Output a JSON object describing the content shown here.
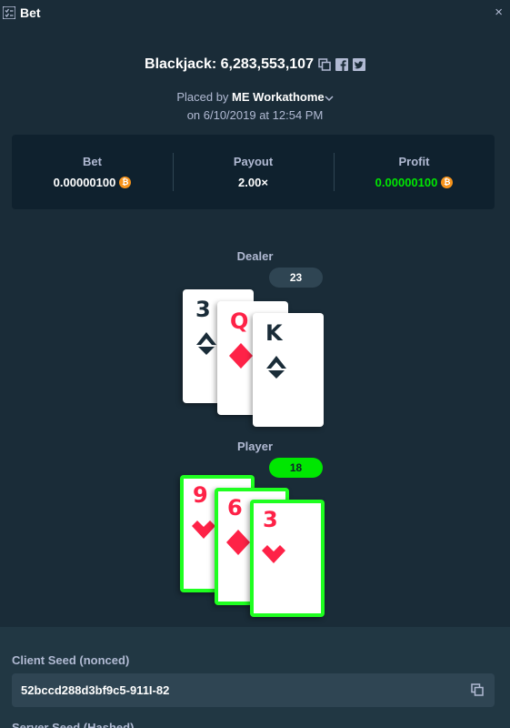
{
  "header": {
    "title": "Bet",
    "icon": "bet-list-icon",
    "close_icon": "close-icon",
    "close_glyph": "×"
  },
  "game": {
    "title": "Blackjack: 6,283,553,107",
    "placed_prefix": "Placed by",
    "user": "ME Workathome",
    "date": "on 6/10/2019 at 12:54 PM",
    "icons": [
      "copy-icon",
      "facebook-icon",
      "twitter-icon"
    ]
  },
  "stats": {
    "bet_label": "Bet",
    "bet_value": "0.00000100",
    "payout_label": "Payout",
    "payout_value": "2.00×",
    "profit_label": "Profit",
    "profit_value": "0.00000100",
    "currency_icon": "bitcoin-icon",
    "currency_glyph": "₿",
    "colors": {
      "profit": "#00e701",
      "currency": "#f7931a"
    }
  },
  "dealer": {
    "label": "Dealer",
    "score": "23",
    "cards": [
      {
        "rank": "3",
        "suit": "spade"
      },
      {
        "rank": "Q",
        "suit": "diamond"
      },
      {
        "rank": "K",
        "suit": "spade"
      }
    ]
  },
  "player": {
    "label": "Player",
    "score": "18",
    "cards": [
      {
        "rank": "9",
        "suit": "heart"
      },
      {
        "rank": "6",
        "suit": "diamond"
      },
      {
        "rank": "3",
        "suit": "heart"
      }
    ]
  },
  "seeds": {
    "client_label": "Client Seed (nonced)",
    "client_value": "52bccd288d3bf9c5-911I-82",
    "server_label": "Server Seed (Hashed)"
  }
}
